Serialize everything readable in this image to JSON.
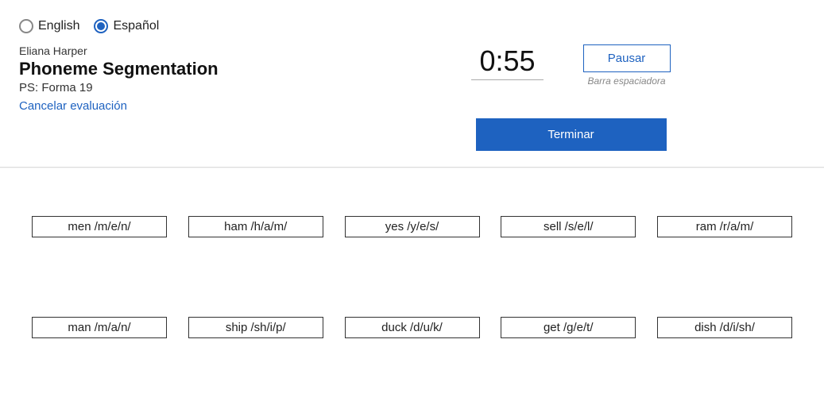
{
  "language": {
    "english_label": "English",
    "spanish_label": "Español"
  },
  "student_name": "Eliana Harper",
  "assessment_title": "Phoneme Segmentation",
  "form_label": "PS: Forma 19",
  "cancel_label": "Cancelar evaluación",
  "timer": "0:55",
  "pause_label": "Pausar",
  "spacebar_hint": "Barra espaciadora",
  "finish_label": "Terminar",
  "items_row1": {
    "0": "men /m/e/n/",
    "1": "ham /h/a/m/",
    "2": "yes /y/e/s/",
    "3": "sell /s/e/l/",
    "4": "ram /r/a/m/"
  },
  "items_row2": {
    "0": "man /m/a/n/",
    "1": "ship /sh/i/p/",
    "2": "duck /d/u/k/",
    "3": "get /g/e/t/",
    "4": "dish /d/i/sh/"
  }
}
